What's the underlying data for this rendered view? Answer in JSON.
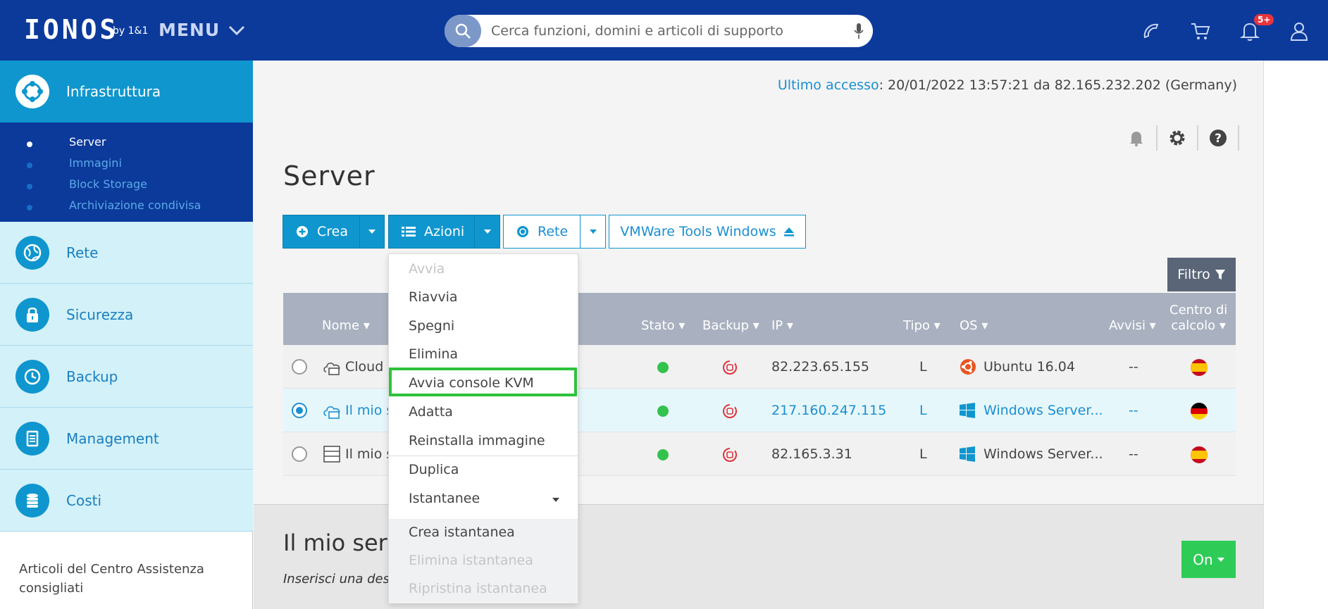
{
  "header": {
    "logo": "IONOS",
    "logo_by": "by 1&1",
    "menu_label": "MENU",
    "search_placeholder": "Cerca funzioni, domini e articoli di supporto",
    "notifications_badge": "5+"
  },
  "sidebar": {
    "main": "Infrastruttura",
    "sub_items": [
      "Server",
      "Immagini",
      "Block Storage",
      "Archiviazione condivisa"
    ],
    "items": [
      "Rete",
      "Sicurezza",
      "Backup",
      "Management",
      "Costi"
    ],
    "help_text": "Articoli del Centro Assistenza consigliati"
  },
  "main": {
    "last_access_label": "Ultimo accesso",
    "last_access_value": ": 20/01/2022 13:57:21 da 82.165.232.202 (Germany)",
    "title": "Server",
    "buttons": {
      "crea": "Crea",
      "azioni": "Azioni",
      "rete": "Rete",
      "vmware": "VMWare Tools Windows",
      "filtro": "Filtro"
    },
    "table": {
      "headers": [
        "Nome",
        "Stato",
        "Backup",
        "IP",
        "Tipo",
        "OS",
        "Avvisi",
        "Centro di",
        "calcolo"
      ],
      "rows": [
        {
          "name": "Cloud S",
          "ip": "82.223.65.155",
          "tipo": "L",
          "os": "Ubuntu 16.04",
          "avvisi": "--",
          "flag": "es"
        },
        {
          "name": "Il mio s",
          "ip": "217.160.247.115",
          "tipo": "L",
          "os": "Windows Server...",
          "avvisi": "--",
          "flag": "de"
        },
        {
          "name": "Il mio s",
          "ip": "82.165.3.31",
          "tipo": "L",
          "os": "Windows Server...",
          "avvisi": "--",
          "flag": "es"
        }
      ]
    },
    "lower": {
      "title": "Il mio serv",
      "subtitle": "Inserisci una desc",
      "on_label": "On"
    }
  },
  "dropdown": {
    "items": [
      "Avvia",
      "Riavvia",
      "Spegni",
      "Elimina",
      "Avvia console KVM",
      "Adatta",
      "Reinstalla immagine",
      "Duplica",
      "Istantanee"
    ],
    "sub_items": [
      "Crea istantanea",
      "Elimina istantanea",
      "Ripristina istantanea"
    ]
  },
  "colors": {
    "topbar": "#0b3a9b",
    "accent": "#0f96ce",
    "highlight": "#2ec23b"
  }
}
